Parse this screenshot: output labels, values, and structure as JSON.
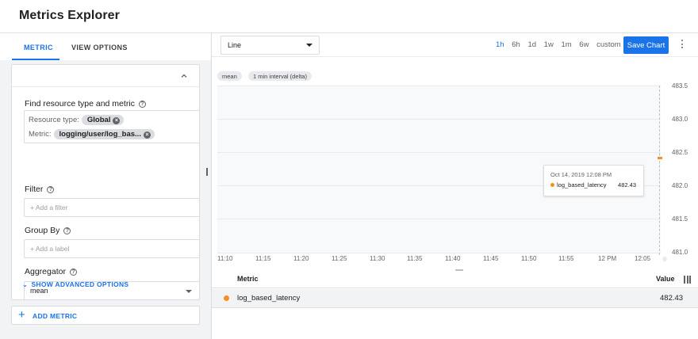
{
  "app": {
    "title": "Metrics Explorer"
  },
  "left_panel": {
    "tabs": [
      {
        "label": "METRIC",
        "active": true
      },
      {
        "label": "VIEW OPTIONS",
        "active": false
      }
    ],
    "find_resource": {
      "label": "Find resource type and metric",
      "resource_type_label": "Resource type:",
      "resource_type_value": "Global",
      "metric_label": "Metric:",
      "metric_value": "logging/user/log_bas..."
    },
    "filter": {
      "label": "Filter",
      "placeholder": "+ Add a filter"
    },
    "group_by": {
      "label": "Group By",
      "placeholder": "+ Add a label"
    },
    "aggregator": {
      "label": "Aggregator",
      "value": "mean"
    },
    "advanced_label": "SHOW ADVANCED OPTIONS",
    "add_metric_label": "ADD METRIC"
  },
  "toolbar": {
    "chart_type": "Line",
    "time_ranges": [
      {
        "label": "1h",
        "active": true
      },
      {
        "label": "6h",
        "active": false
      },
      {
        "label": "1d",
        "active": false
      },
      {
        "label": "1w",
        "active": false
      },
      {
        "label": "1m",
        "active": false
      },
      {
        "label": "6w",
        "active": false
      },
      {
        "label": "custom",
        "active": false
      }
    ],
    "save_label": "Save Chart"
  },
  "chart_pills": {
    "aligner": "mean",
    "interval": "1 min interval (delta)"
  },
  "chart_data": {
    "type": "line",
    "title": "",
    "xlabel": "",
    "ylabel": "",
    "x_ticks": [
      "11:10",
      "11:15",
      "11:20",
      "11:25",
      "11:30",
      "11:35",
      "11:40",
      "11:45",
      "11:50",
      "11:55",
      "12 PM",
      "12:05"
    ],
    "y_ticks": [
      "483.5",
      "483.0",
      "482.5",
      "482.0",
      "481.5",
      "481.0"
    ],
    "ylim": [
      481.0,
      483.5
    ],
    "grid": true,
    "series": [
      {
        "name": "log_based_latency",
        "color": "#f4911e",
        "x": [
          "12:08"
        ],
        "values": [
          482.43
        ]
      }
    ]
  },
  "tooltip": {
    "time": "Oct 14, 2019 12:08 PM",
    "series": "log_based_latency",
    "value": "482.43",
    "color": "#f4911e"
  },
  "legend_table": {
    "headers": {
      "metric": "Metric",
      "value": "Value"
    },
    "rows": [
      {
        "metric": "log_based_latency",
        "value": "482.43",
        "color": "#f4911e"
      }
    ]
  },
  "colors": {
    "accent": "#1a73e8",
    "series": "#f4911e"
  }
}
